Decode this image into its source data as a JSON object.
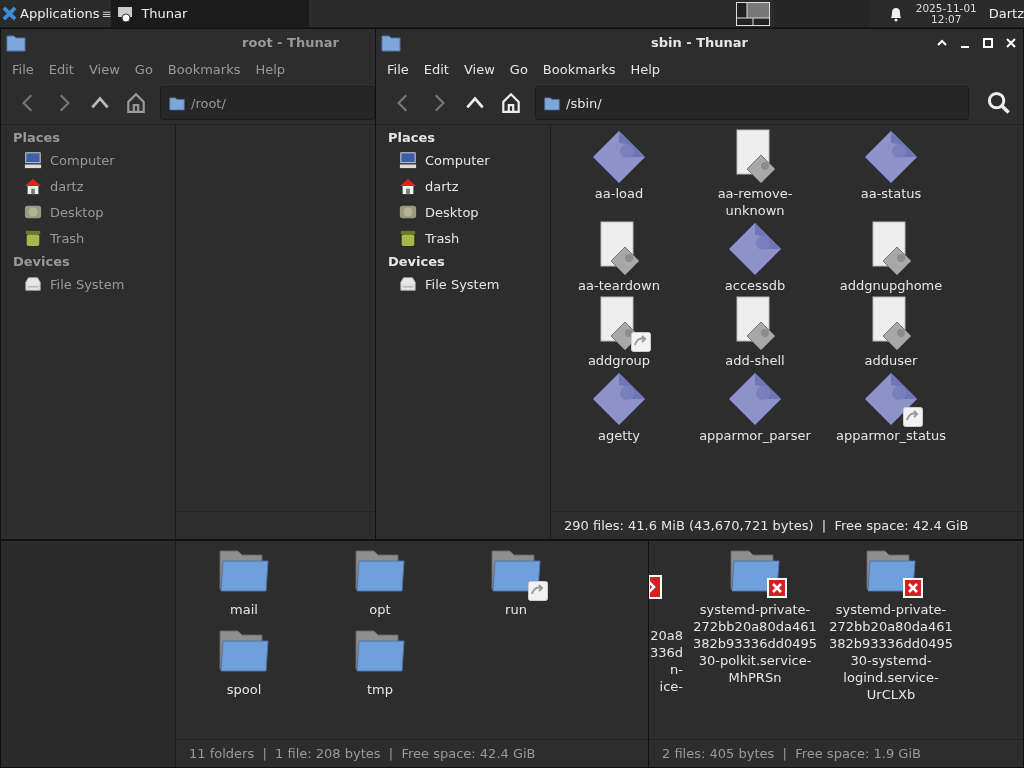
{
  "panel": {
    "apps_label": "Applications",
    "menu_glyph": "≡",
    "tasks": [
      {
        "label": "Thunar",
        "selected": true
      }
    ],
    "clock": {
      "date": "2025-11-01",
      "time": "12:07"
    },
    "user": "Dartz"
  },
  "windows": [
    {
      "title": "root - Thunar",
      "active": false,
      "menu": [
        "File",
        "Edit",
        "View",
        "Go",
        "Bookmarks",
        "Help"
      ],
      "path": "/root/",
      "sidebar": [
        {
          "heading": "Places",
          "items": [
            {
              "label": "Computer",
              "kind": "computer"
            },
            {
              "label": "dartz",
              "kind": "home"
            },
            {
              "label": "Desktop",
              "kind": "desktop"
            },
            {
              "label": "Trash",
              "kind": "trash"
            }
          ]
        },
        {
          "heading": "Devices",
          "items": [
            {
              "label": "File System",
              "kind": "drive"
            }
          ]
        }
      ]
    },
    {
      "title": "sbin - Thunar",
      "active": true,
      "menu": [
        "File",
        "Edit",
        "View",
        "Go",
        "Bookmarks",
        "Help"
      ],
      "path": "/sbin/",
      "sidebar": [
        {
          "heading": "Places",
          "items": [
            {
              "label": "Computer",
              "kind": "computer"
            },
            {
              "label": "dartz",
              "kind": "home"
            },
            {
              "label": "Desktop",
              "kind": "desktop"
            },
            {
              "label": "Trash",
              "kind": "trash"
            }
          ]
        },
        {
          "heading": "Devices",
          "items": [
            {
              "label": "File System",
              "kind": "drive"
            }
          ]
        }
      ],
      "items": [
        {
          "name": "aa-load",
          "kind": "program",
          "link": false
        },
        {
          "name": "aa-remove-unknown",
          "kind": "script",
          "link": false
        },
        {
          "name": "aa-status",
          "kind": "program",
          "link": false
        },
        {
          "name": "aa-teardown",
          "kind": "script",
          "link": false
        },
        {
          "name": "accessdb",
          "kind": "program",
          "link": false
        },
        {
          "name": "addgnupghome",
          "kind": "script",
          "link": false
        },
        {
          "name": "addgroup",
          "kind": "script",
          "link": true
        },
        {
          "name": "add-shell",
          "kind": "script",
          "link": false
        },
        {
          "name": "adduser",
          "kind": "script",
          "link": false
        },
        {
          "name": "agetty",
          "kind": "program",
          "link": false
        },
        {
          "name": "apparmor_parser",
          "kind": "program",
          "link": false
        },
        {
          "name": "apparmor_status",
          "kind": "program",
          "link": true
        }
      ],
      "status": "290 files: 41.6 MiB (43,670,721 bytes)  |  Free space: 42.4 GiB"
    }
  ],
  "background_windows": [
    {
      "items": [
        {
          "name": "mail",
          "kind": "folder",
          "link": false
        },
        {
          "name": "opt",
          "kind": "folder",
          "link": false
        },
        {
          "name": "run",
          "kind": "folder",
          "link": true
        },
        {
          "name": "spool",
          "kind": "folder",
          "link": false
        },
        {
          "name": "tmp",
          "kind": "folder",
          "link": false
        }
      ],
      "status": "11 folders  |  1 file: 208 bytes  |  Free space: 42.4 GiB"
    },
    {
      "cut_item_lines": [
        "20a8",
        "336d",
        "n-",
        "ice-"
      ],
      "items": [
        {
          "name": "systemd-private-272bb20a80da461382b93336dd049530-polkit.service-MhPRSn",
          "kind": "folder",
          "unreadable": true
        },
        {
          "name": "systemd-private-272bb20a80da461382b93336dd049530-systemd-logind.service-UrCLXb",
          "kind": "folder",
          "unreadable": true
        }
      ],
      "status": "2 files: 405 bytes  |  Free space: 1.9 GiB"
    }
  ]
}
